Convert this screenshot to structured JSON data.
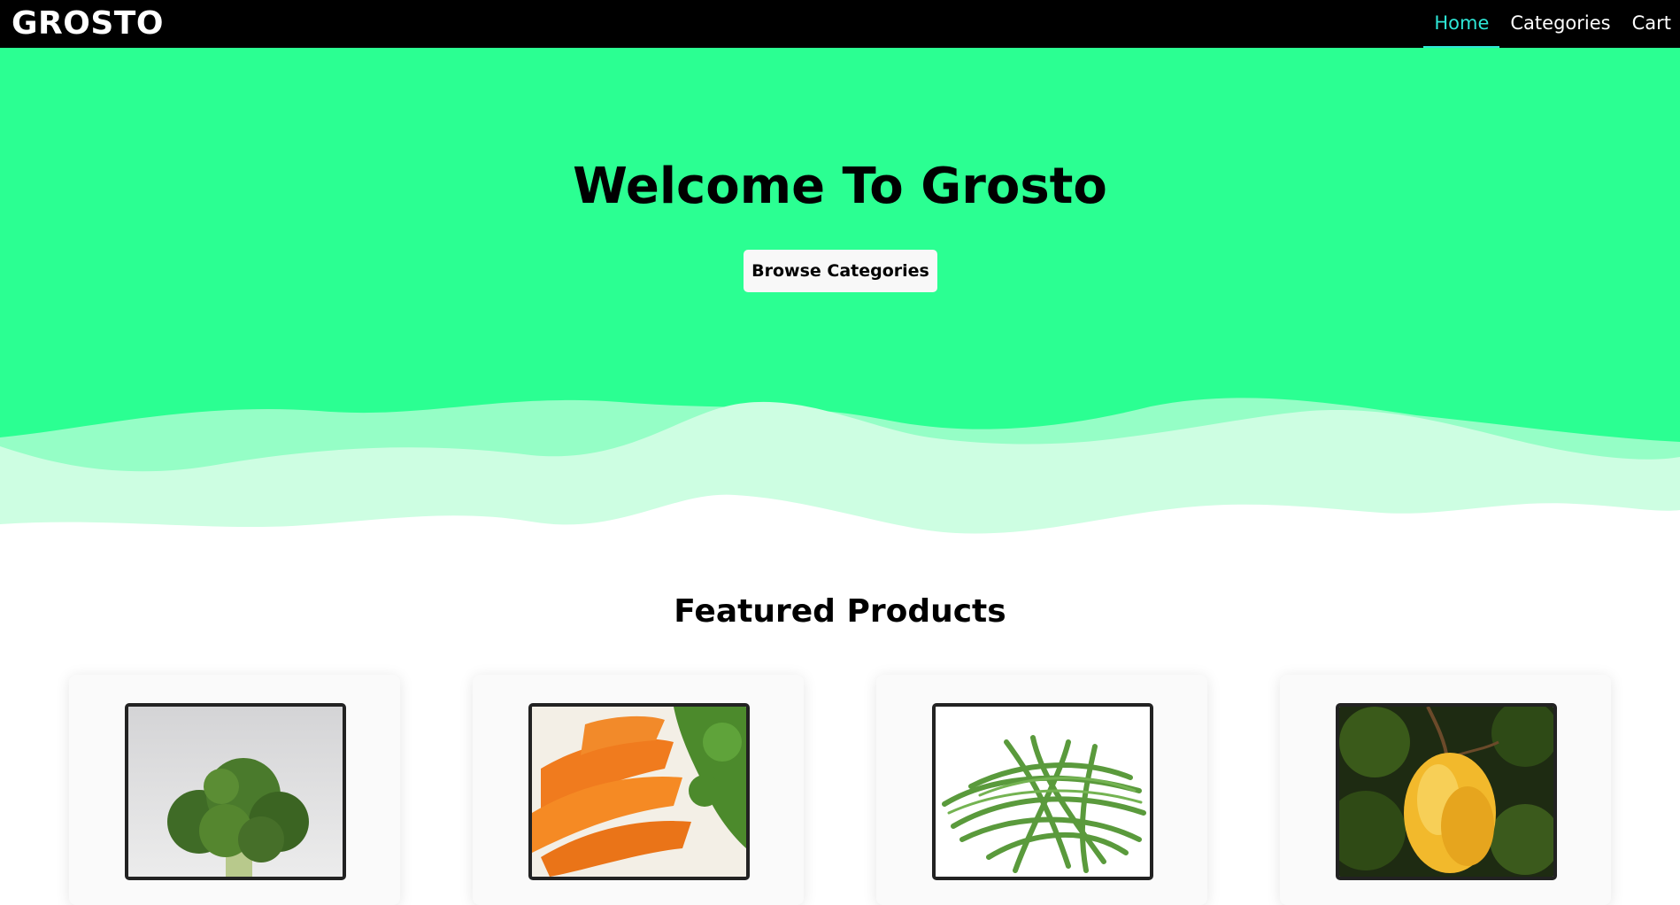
{
  "navbar": {
    "brand": "GROSTO",
    "links": [
      {
        "label": "Home",
        "active": true
      },
      {
        "label": "Categories",
        "active": false
      },
      {
        "label": "Cart",
        "active": false
      }
    ]
  },
  "hero": {
    "title": "Welcome To Grosto",
    "button_label": "Browse Categories",
    "background_color": "#2bff92"
  },
  "featured": {
    "title": "Featured Products",
    "products": [
      {
        "image": "broccoli-image"
      },
      {
        "image": "carrots-image"
      },
      {
        "image": "green-beans-image"
      },
      {
        "image": "mango-image"
      }
    ]
  },
  "colors": {
    "accent": "#2ee6d6",
    "hero_green": "#2bff92",
    "wave_mid": "#95fec6",
    "wave_light": "#cdfee2"
  }
}
